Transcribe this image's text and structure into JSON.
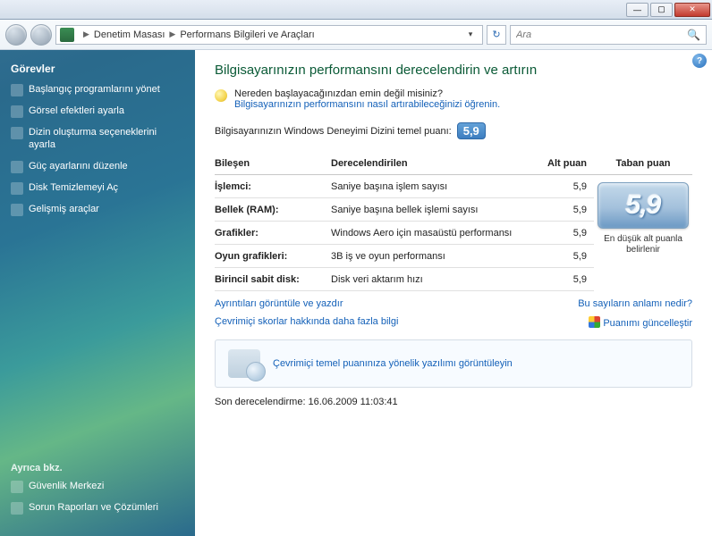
{
  "titlebar": {
    "min": "—",
    "max": "▢",
    "close": "✕"
  },
  "nav": {
    "crumb1": "Denetim Masası",
    "crumb2": "Performans Bilgileri ve Araçları",
    "search_placeholder": "Ara"
  },
  "sidebar": {
    "tasks_head": "Görevler",
    "items": [
      "Başlangıç programlarını yönet",
      "Görsel efektleri ayarla",
      "Dizin oluşturma seçeneklerini ayarla",
      "Güç ayarlarını düzenle",
      "Disk Temizlemeyi Aç",
      "Gelişmiş araçlar"
    ],
    "see_head": "Ayrıca bkz.",
    "see_items": [
      "Güvenlik Merkezi",
      "Sorun Raporları ve Çözümleri"
    ]
  },
  "content": {
    "heading": "Bilgisayarınızın performansını derecelendirin ve artırın",
    "hint_q": "Nereden başlayacağınızdan emin değil misiniz?",
    "hint_link": "Bilgisayarınızın performansını nasıl artırabileceğinizi öğrenin.",
    "base_label": "Bilgisayarınızın Windows Deneyimi Dizini temel puanı:",
    "base_score": "5,9",
    "table": {
      "h_component": "Bileşen",
      "h_rated": "Derecelendirilen",
      "h_sub": "Alt puan",
      "h_base": "Taban puan",
      "rows": [
        {
          "c": "İşlemci:",
          "r": "Saniye başına işlem sayısı",
          "s": "5,9"
        },
        {
          "c": "Bellek (RAM):",
          "r": "Saniye başına bellek işlemi sayısı",
          "s": "5,9"
        },
        {
          "c": "Grafikler:",
          "r": "Windows Aero için masaüstü performansı",
          "s": "5,9"
        },
        {
          "c": "Oyun grafikleri:",
          "r": "3B iş ve oyun performansı",
          "s": "5,9"
        },
        {
          "c": "Birincil sabit disk:",
          "r": "Disk veri aktarım hızı",
          "s": "5,9"
        }
      ],
      "big_label": "En düşük alt puanla belirlenir"
    },
    "link_details": "Ayrıntıları görüntüle ve yazdır",
    "link_meaning": "Bu sayıların anlamı nedir?",
    "link_online": "Çevrimiçi skorlar hakkında daha fazla bilgi",
    "link_update": "Puanımı güncelleştir",
    "softbox": "Çevrimiçi temel puanınıza yönelik yazılımı görüntüleyin",
    "last_rated": "Son derecelendirme: 16.06.2009 11:03:41"
  }
}
